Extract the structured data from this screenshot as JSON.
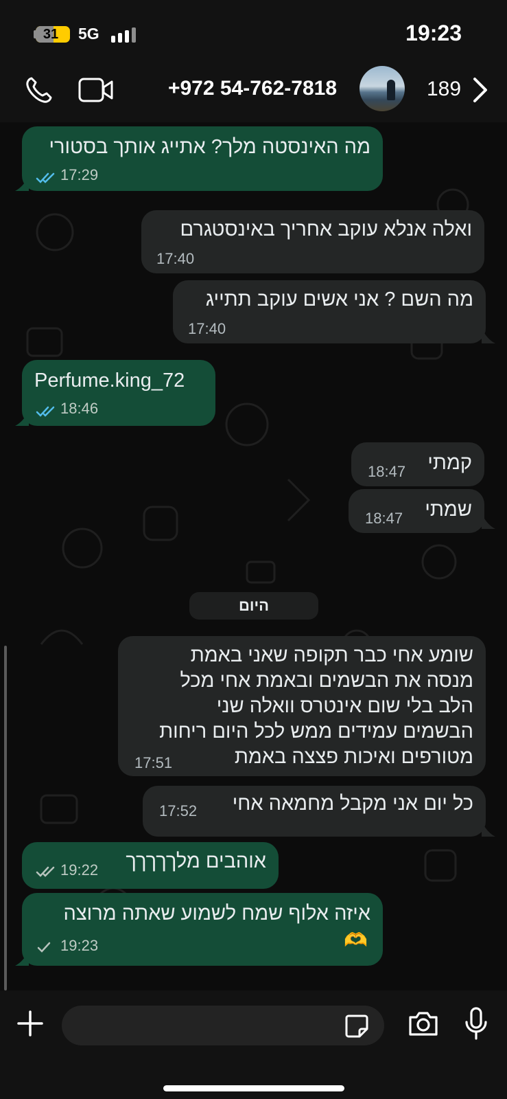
{
  "status_bar": {
    "battery": "31",
    "network": "5G",
    "time": "19:23"
  },
  "header": {
    "contact": "+972 54-762-7818",
    "count": "189",
    "icons": [
      "phone-icon",
      "video-icon",
      "chevron-right-icon"
    ]
  },
  "messages": [
    {
      "dir": "out",
      "text": "מה האינסטה מלך? אתייג אותך בסטורי",
      "time": "17:29",
      "status": "read"
    },
    {
      "dir": "in",
      "text": "ואלה אנלא עוקב אחריך באינסטגרם",
      "time": "17:40"
    },
    {
      "dir": "in",
      "text": "מה השם ? אני אשים עוקב תתייג",
      "time": "17:40"
    },
    {
      "dir": "out",
      "text": "Perfume.king_72",
      "time": "18:46",
      "status": "read"
    },
    {
      "dir": "in",
      "text": "קמתי",
      "time": "18:47"
    },
    {
      "dir": "in",
      "text": "שמתי",
      "time": "18:47"
    },
    {
      "dir": "in",
      "lines": [
        "שומע אחי כבר תקופה שאני באמת",
        "מנסה את הבשמים ובאמת אחי מכל",
        "הלב בלי שום אינטרס וואלה שני",
        "הבשמים עמידים ממש לכל היום ריחות",
        "מטורפים ואיכות פצצה באמת"
      ],
      "time": "17:51"
    },
    {
      "dir": "in",
      "text": "כל יום אני מקבל מחמאה אחי",
      "time": "17:52"
    },
    {
      "dir": "out",
      "text": "אוהבים מלךךךךך",
      "time": "19:22",
      "status": "delivered"
    },
    {
      "dir": "out",
      "text": "איזה אלוף שמח לשמוע שאתה מרוצה",
      "emoji": "🫶",
      "time": "19:23",
      "status": "sent"
    }
  ],
  "date_separator": "היום",
  "input": {
    "placeholder": "",
    "icons": [
      "plus-icon",
      "sticker-icon",
      "camera-icon",
      "microphone-icon"
    ]
  },
  "colors": {
    "outgoing_bubble": "#144d37",
    "incoming_bubble": "#242626",
    "read_ticks": "#53bdeb",
    "background": "#0c0c0c"
  }
}
